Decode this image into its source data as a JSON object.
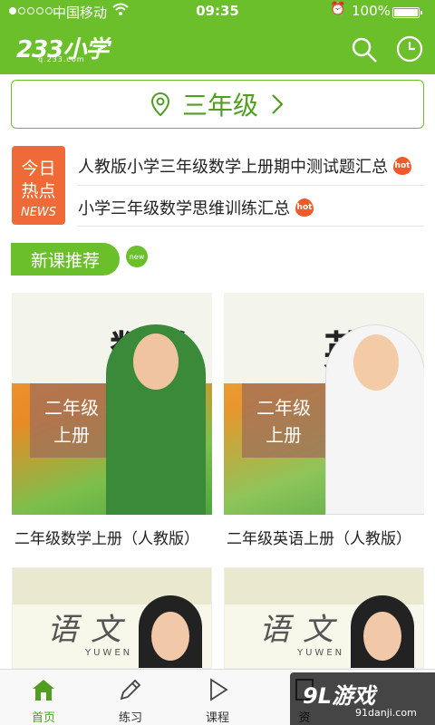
{
  "status_bar": {
    "carrier": "中国移动",
    "time": "09:35",
    "battery": "100%"
  },
  "header": {
    "logo": "233小学",
    "logo_url": "q.233.com"
  },
  "grade_selector": {
    "label": "三年级"
  },
  "hot_news": {
    "badge_line1": "今日",
    "badge_line2": "热点",
    "badge_line3": "NEWS",
    "items": [
      {
        "title": "人教版小学三年级数学上册期中测试题汇总",
        "tag": "hot"
      },
      {
        "title": "小学三年级数学思维训练汇总",
        "tag": "hot"
      }
    ]
  },
  "new_courses": {
    "heading": "新课推荐",
    "badge": "new",
    "cards": [
      {
        "title": "二年级数学上册（人教版）",
        "cover_subject": "数学",
        "cover_grade_1": "二年级",
        "cover_grade_2": "上册"
      },
      {
        "title": "二年级英语上册（人教版）",
        "cover_subject": "英语",
        "cover_grade_1": "二年级",
        "cover_grade_2": "上册"
      },
      {
        "cover_subject": "语文",
        "cover_pinyin": "YUWEN"
      },
      {
        "cover_subject": "语文",
        "cover_pinyin": "YUWEN"
      }
    ]
  },
  "tabbar": {
    "tabs": [
      {
        "label": "首页",
        "active": true
      },
      {
        "label": "练习"
      },
      {
        "label": "课程"
      },
      {
        "label": "资"
      }
    ]
  },
  "watermark": {
    "main": "9L游戏",
    "sub": "91danji.com"
  },
  "colors": {
    "brand": "#6abf2a",
    "hot": "#ef6a36"
  }
}
